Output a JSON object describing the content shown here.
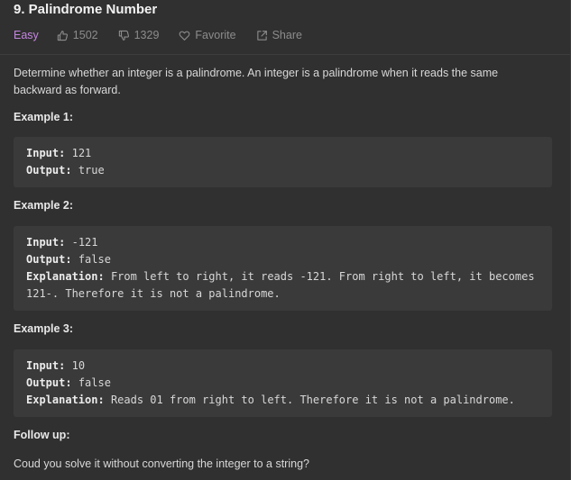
{
  "problem": {
    "title": "9. Palindrome Number",
    "difficulty": "Easy",
    "likes": "1502",
    "dislikes": "1329",
    "favorite_label": "Favorite",
    "share_label": "Share"
  },
  "description": "Determine whether an integer is a palindrome. An integer is a palindrome when it reads the same backward as forward.",
  "examples": [
    {
      "heading": "Example 1:",
      "input_label": "Input:",
      "input": "121",
      "output_label": "Output:",
      "output": "true"
    },
    {
      "heading": "Example 2:",
      "input_label": "Input:",
      "input": "-121",
      "output_label": "Output:",
      "output": "false",
      "explanation_label": "Explanation:",
      "explanation": "From left to right, it reads -121. From right to left, it becomes 121-. Therefore it is not a palindrome."
    },
    {
      "heading": "Example 3:",
      "input_label": "Input:",
      "input": "10",
      "output_label": "Output:",
      "output": "false",
      "explanation_label": "Explanation:",
      "explanation": "Reads 01 from right to left. Therefore it is not a palindrome."
    }
  ],
  "follow_up": {
    "heading": "Follow up:",
    "text": "Coud you solve it without converting the integer to a string?"
  },
  "colors": {
    "background": "#303030",
    "difficulty_easy": "#c586e0",
    "code_background": "#3a3a3a"
  },
  "icons": [
    "thumbs-up-icon",
    "thumbs-down-icon",
    "heart-icon",
    "share-icon"
  ]
}
